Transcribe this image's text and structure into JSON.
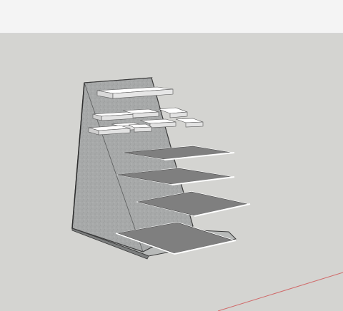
{
  "app": {
    "toolbar_text": "",
    "viewport_background": "#d4d4d1"
  },
  "model": {
    "description_visible": false,
    "upper_tiles_count": 10,
    "tray_count": 4,
    "colors": {
      "stand_side": "#a9abab",
      "stand_edge": "#3a3a3a",
      "base": "#b8bab9",
      "tile_top": "#ffffff",
      "tile_side": "#cfcfcf",
      "tray_top": "#808080",
      "tray_edge": "#ffffff",
      "axis_red": "#d06a6a"
    },
    "icons": [
      "red-axis-line-icon"
    ]
  }
}
